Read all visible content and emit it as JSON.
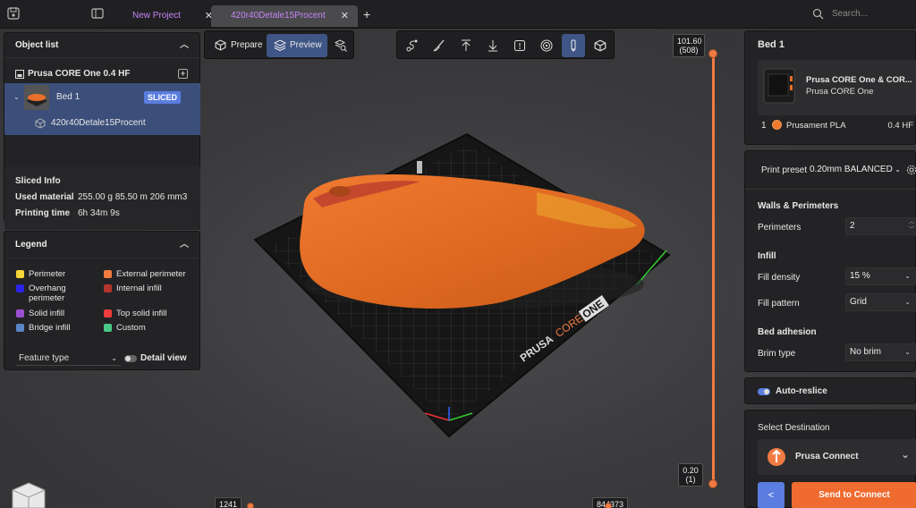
{
  "titlebar": {
    "tabs": [
      {
        "label": "New Project",
        "close": "✕"
      },
      {
        "label": "420r40Detale15Procent",
        "close": "✕"
      }
    ],
    "new_tab": "+",
    "search_placeholder": "Search..."
  },
  "object_list": {
    "title": "Object list",
    "printer": "Prusa CORE One 0.4 HF",
    "bed": {
      "name": "Bed 1",
      "badge": "SLICED"
    },
    "part": "420r40Detale15Procent"
  },
  "sliced_info": {
    "title": "Sliced Info",
    "used_material_label": "Used material",
    "used_material_value": "255.00 g  85.50 m  206 mm3",
    "printing_time_label": "Printing time",
    "printing_time_value": "6h 34m 9s"
  },
  "legend": {
    "title": "Legend",
    "items": [
      {
        "label": "Perimeter",
        "color": "#f5d536"
      },
      {
        "label": "External perimeter",
        "color": "#f07c3e"
      },
      {
        "label": "Overhang perimeter",
        "color": "#2a25e6"
      },
      {
        "label": "Internal infill",
        "color": "#b4352d"
      },
      {
        "label": "Solid infill",
        "color": "#9a4fd2"
      },
      {
        "label": "Top solid infill",
        "color": "#ee3b3b"
      },
      {
        "label": "Bridge infill",
        "color": "#5a86c6"
      },
      {
        "label": "Custom",
        "color": "#49c985"
      }
    ],
    "view_type": "Feature type",
    "detail_view": "Detail view"
  },
  "view_switch": {
    "prepare": "Prepare",
    "preview": "Preview"
  },
  "toolbar_icons": [
    "path-icon",
    "paint-brush-icon",
    "arrow-up-icon",
    "arrow-down-icon",
    "info-icon",
    "target-icon",
    "pen-icon",
    "cube-icon"
  ],
  "layer_slider": {
    "top": "101.60",
    "top_layer": "(508)",
    "bottom": "0.20",
    "bottom_layer": "(1)"
  },
  "horizontal_slider": {
    "left": "1241",
    "right": "844373"
  },
  "plate": {
    "brand": "PRUSA",
    "model_core": "CORE",
    "model_one": "ONE"
  },
  "bed_panel": {
    "title": "Bed 1",
    "printer_name": "Prusa CORE One & COR...",
    "printer_model": "Prusa CORE One",
    "extruder_number": "1",
    "filament": "Prusament PLA",
    "nozzle": "0.4 HF",
    "filament_color": "#ef7b2d"
  },
  "settings": {
    "print_preset_label": "Print preset",
    "print_preset_value": "0.20mm BALANCED",
    "walls_title": "Walls & Perimeters",
    "perimeters_label": "Perimeters",
    "perimeters_value": "2",
    "infill_title": "Infill",
    "fill_density_label": "Fill density",
    "fill_density_value": "15 %",
    "fill_pattern_label": "Fill pattern",
    "fill_pattern_value": "Grid",
    "bed_adhesion_title": "Bed adhesion",
    "brim_type_label": "Brim type",
    "brim_type_value": "No brim"
  },
  "auto_reslice": "Auto-reslice",
  "destination": {
    "title": "Select Destination",
    "value": "Prusa Connect",
    "back": "<",
    "send": "Send to Connect"
  },
  "colors": {
    "accent": "#ef7b43",
    "selection": "#3c4f7a",
    "primary": "#5b7de0",
    "model": "#e8702a"
  }
}
